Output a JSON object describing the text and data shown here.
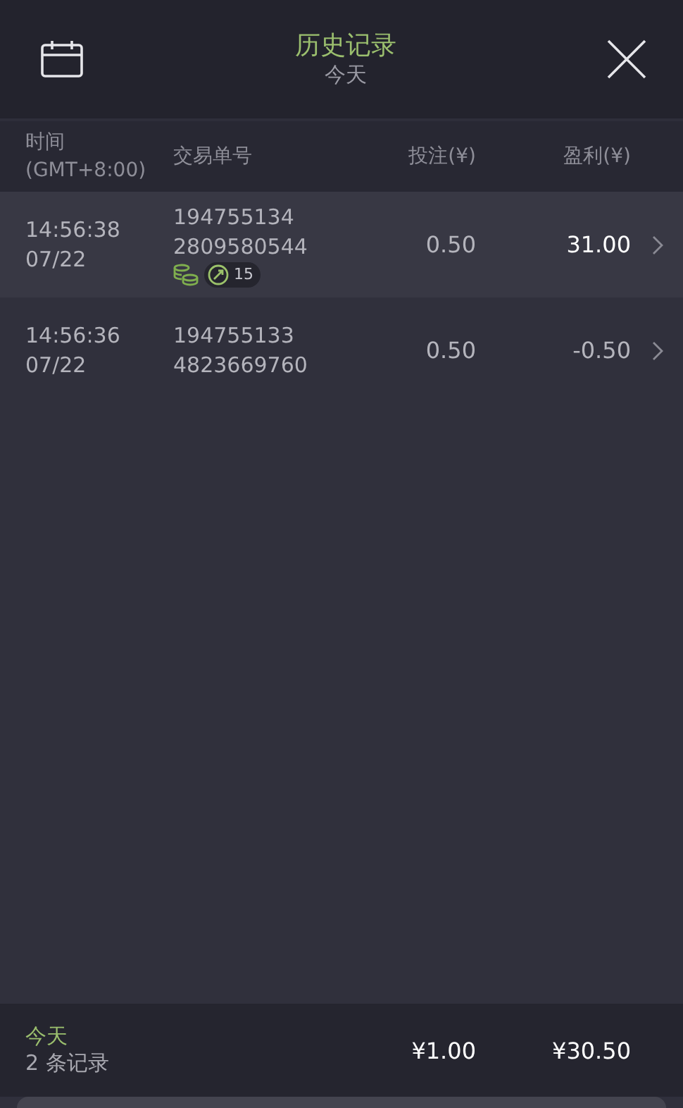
{
  "header": {
    "title": "历史记录",
    "subtitle": "今天"
  },
  "columns": [
    "时间\n(GMT+8:00)",
    "交易单号",
    "投注(¥)",
    "盈利(¥)"
  ],
  "rows": [
    {
      "time": "14:56:38",
      "date": "07/22",
      "order_1": "194755134",
      "order_2": "2809580544",
      "stake": "0.50",
      "profit": "31.00",
      "win": true,
      "tags": [
        {
          "kind": "coins"
        },
        {
          "kind": "multiplier",
          "count": "15"
        }
      ]
    },
    {
      "time": "14:56:36",
      "date": "07/22",
      "order_1": "194755133",
      "order_2": "4823669760",
      "stake": "0.50",
      "profit": "-0.50",
      "win": false,
      "tags": []
    }
  ],
  "footer": {
    "period": "今天",
    "count": "2 条记录",
    "total_stake": "¥1.00",
    "total_profit": "¥30.50"
  }
}
